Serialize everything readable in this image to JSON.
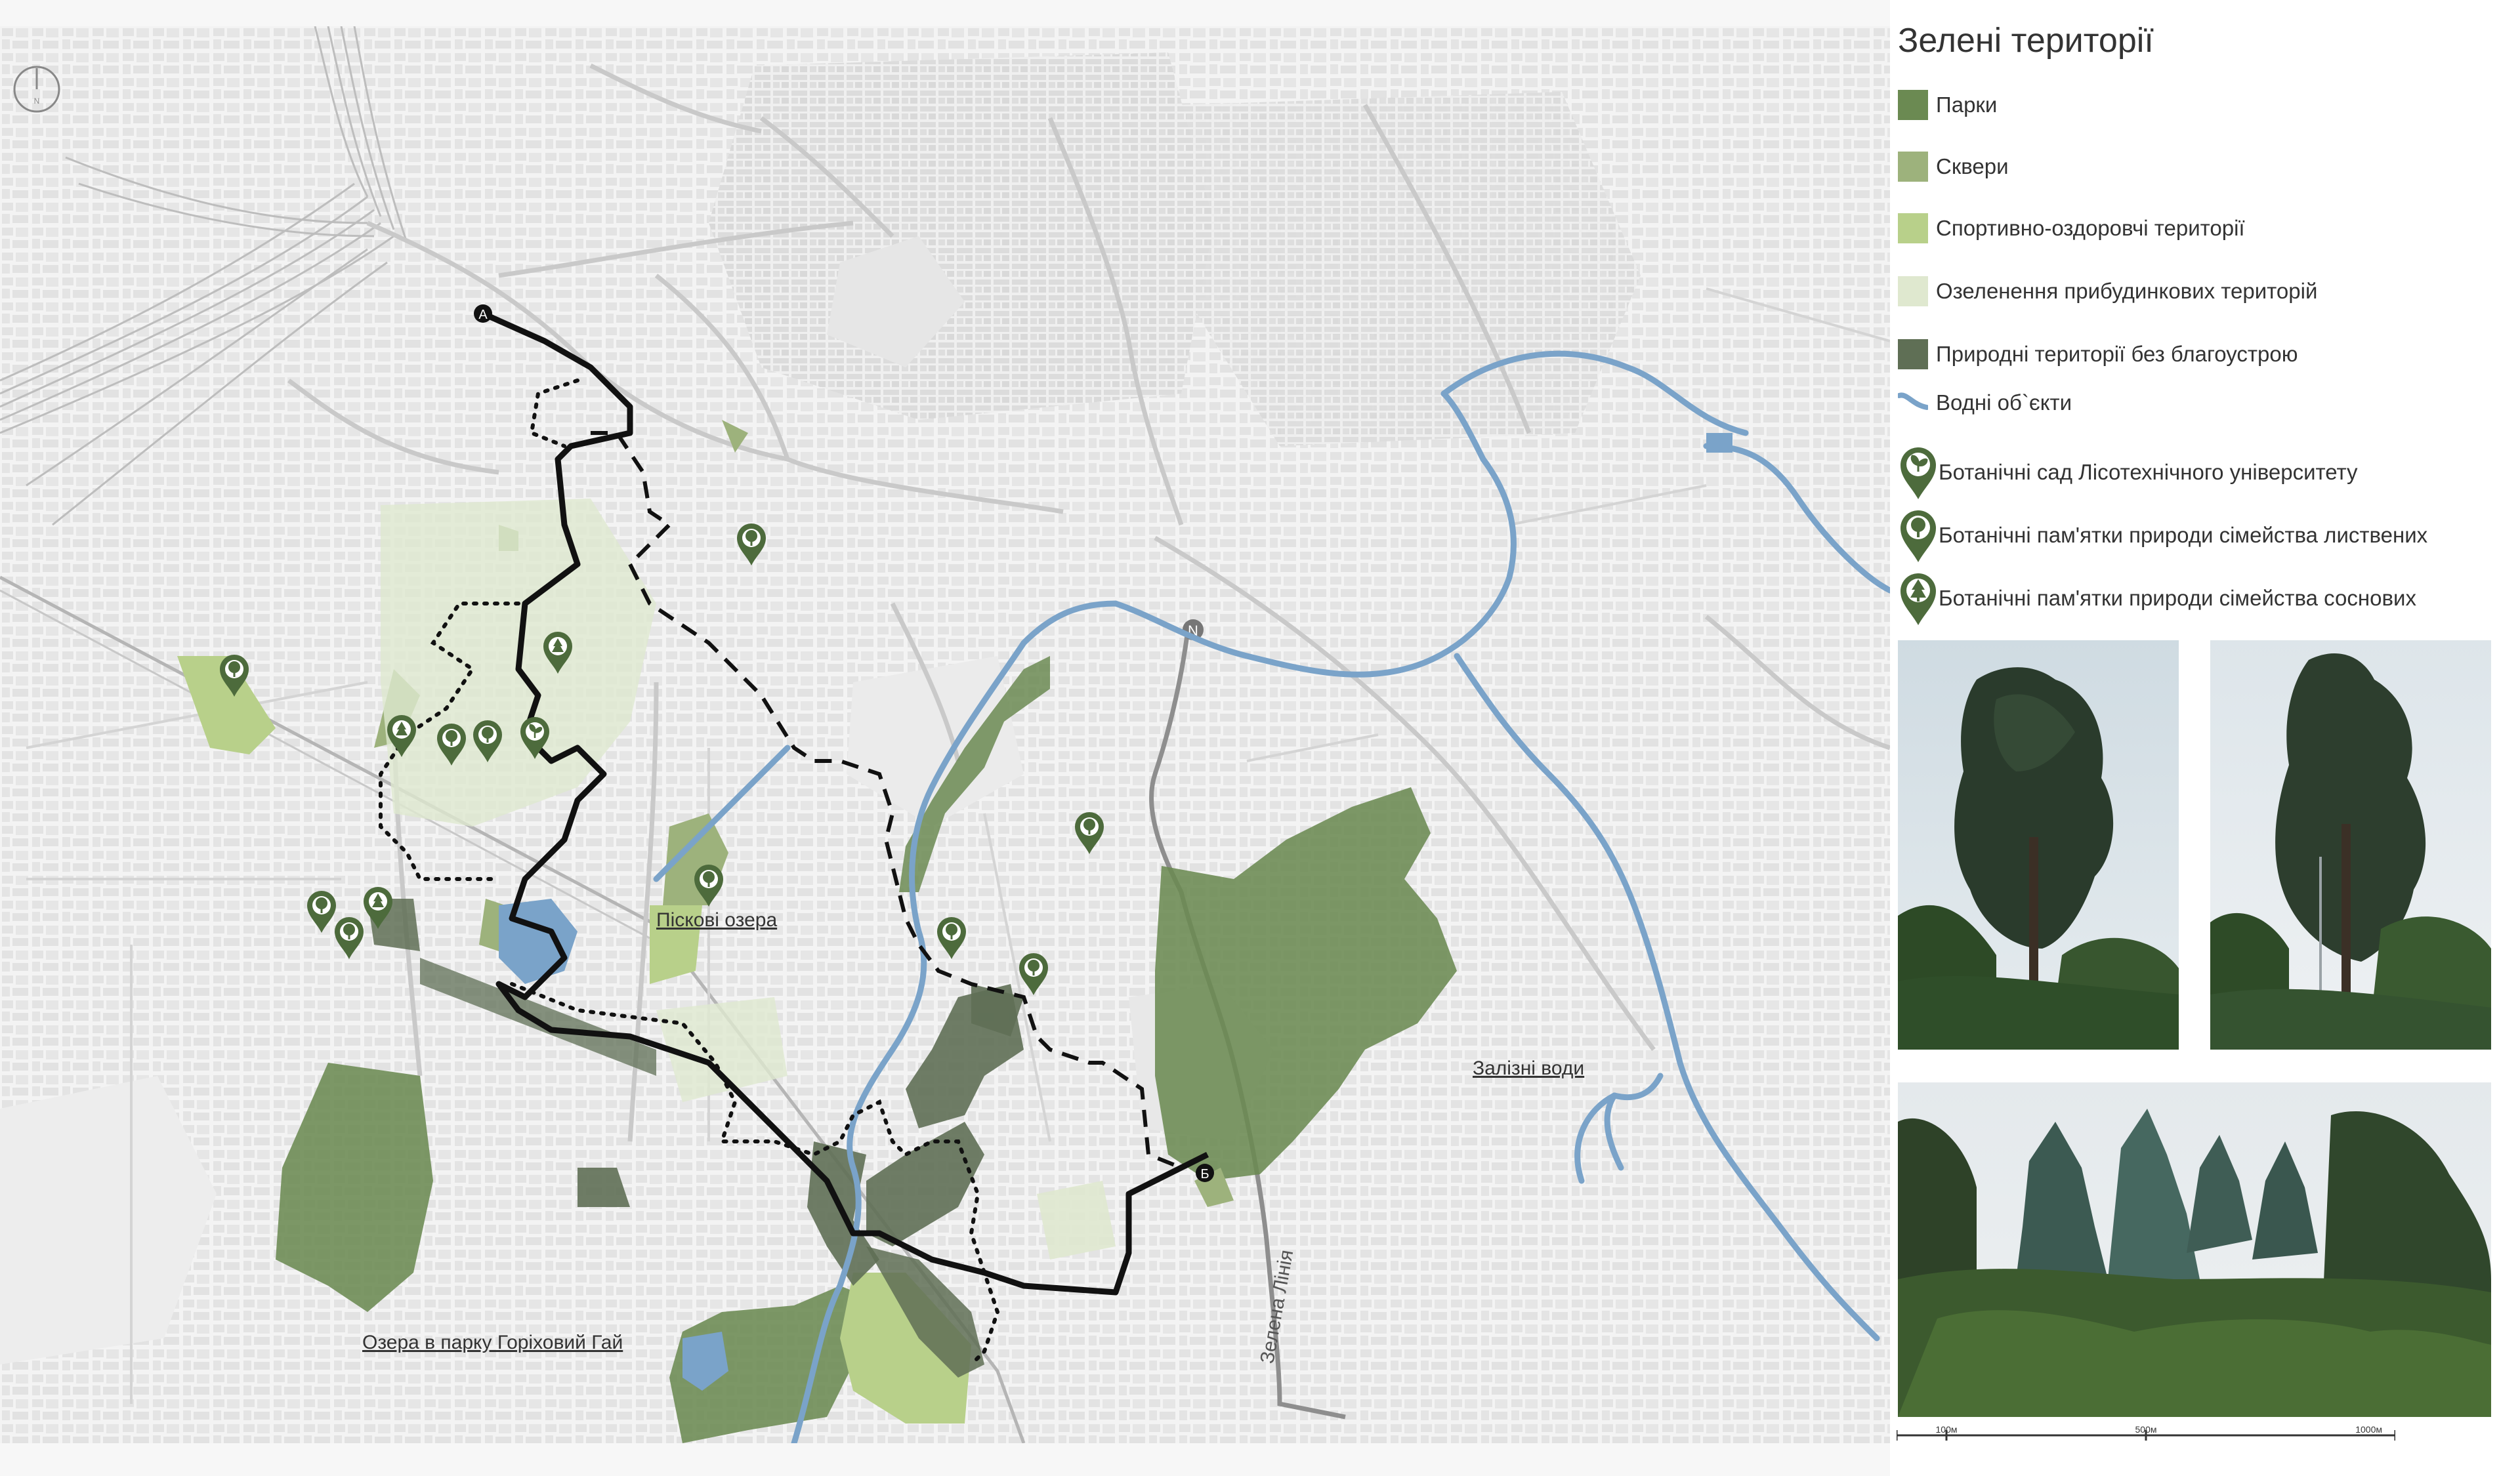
{
  "legend": {
    "title": "Зелені території",
    "items": [
      {
        "label": "Парки",
        "color": "#6b8a52",
        "kind": "swatch"
      },
      {
        "label": "Сквери",
        "color": "#9db27c",
        "kind": "swatch"
      },
      {
        "label": "Спортивно-оздоровчі території",
        "color": "#b8d08a",
        "kind": "swatch"
      },
      {
        "label": "Озеленення прибудинкових територій",
        "color": "#dfe8cf",
        "kind": "swatch"
      },
      {
        "label": "Природні території без благоустрою",
        "color": "#5f6f55",
        "kind": "swatch"
      },
      {
        "label": "Водні об`єкти",
        "color": "#7aa3c9",
        "kind": "water"
      },
      {
        "label": "Ботанічні сад Лісотехнічного університету",
        "color": "#4d6b3c",
        "kind": "pin-sprout"
      },
      {
        "label": "Ботанічні пам'ятки природи сімейства листвених",
        "color": "#4d6b3c",
        "kind": "pin-tree"
      },
      {
        "label": "Ботанічні пам'ятки природи сімейства соснових",
        "color": "#4d6b3c",
        "kind": "pin-pine"
      }
    ]
  },
  "map_labels": {
    "lakes_pisky": "Піскові озера",
    "zalizni_vody": "Залізні води",
    "lakes_park": "Озера в парку Горіховий Гай",
    "green_line": "Зелена Лінія",
    "point_a": "А",
    "point_b": "Б",
    "north": "N"
  },
  "scale": {
    "labels": [
      "100м",
      "500м",
      "1000м"
    ]
  },
  "colors": {
    "park": "#6b8a52",
    "square": "#9db27c",
    "sport": "#b8d08a",
    "yard": "#dfe8cf",
    "natural": "#5f6f55",
    "water": "#7aa3c9",
    "pin": "#4d6b3c",
    "route": "#111111"
  }
}
